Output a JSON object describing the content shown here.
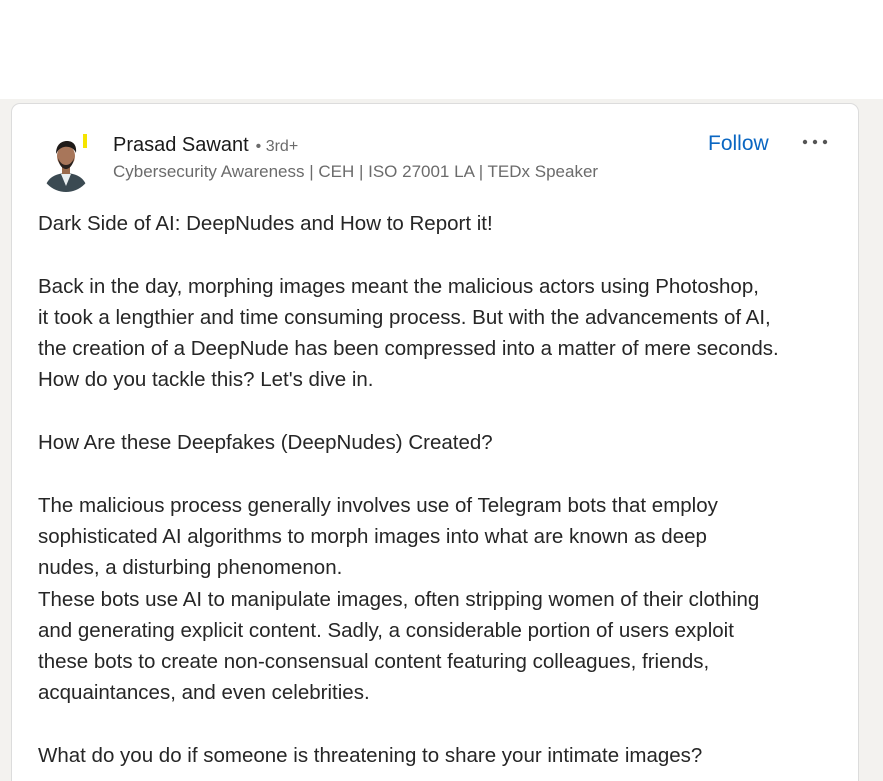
{
  "author": {
    "name": "Prasad Sawant",
    "degree": "• 3rd+",
    "headline": "Cybersecurity Awareness | CEH | ISO 27001 LA | TEDx Speaker"
  },
  "actions": {
    "follow_label": "Follow",
    "more_icon": "ellipsis-icon"
  },
  "colors": {
    "accent": "#0a66c2",
    "feed_background": "#f3f2ef",
    "avatar_badge": "#f5e400"
  },
  "post": {
    "lines": [
      "Dark Side of AI: DeepNudes and How to Report it!",
      "",
      "Back in the day, morphing images meant the malicious actors using Photoshop,",
      "it took a lengthier and time consuming process. But with the advancements of AI,",
      "the creation of a DeepNude has been compressed into a matter of mere seconds.",
      "How do you tackle this? Let's dive in.",
      "",
      "How Are these Deepfakes (DeepNudes) Created?",
      "",
      "The malicious process generally involves use of Telegram bots that employ",
      "sophisticated AI algorithms to morph images into what are known as deep",
      "nudes, a disturbing phenomenon.",
      "These bots use AI to manipulate images, often stripping women of their clothing",
      "and generating explicit content. Sadly, a considerable portion of users exploit",
      "these bots to create non-consensual content featuring colleagues, friends,",
      "acquaintances, and even celebrities.",
      "",
      "What do you do if someone is threatening to share your intimate images?"
    ]
  }
}
